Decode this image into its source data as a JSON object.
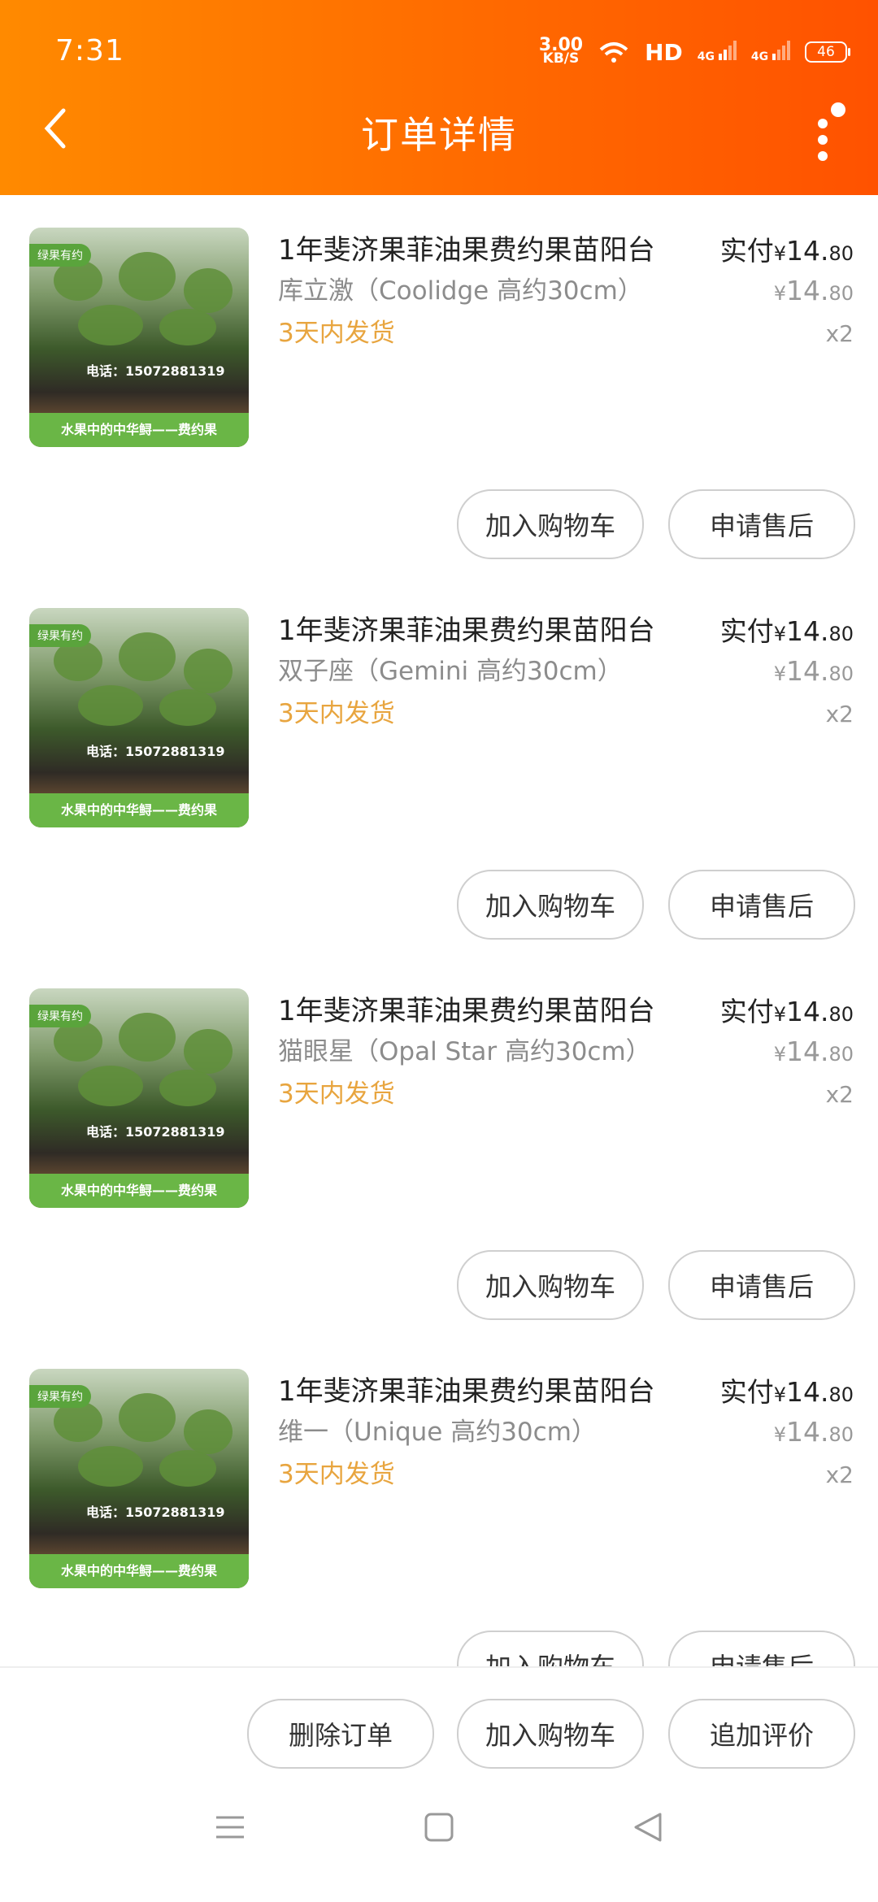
{
  "status_bar": {
    "time": "7:31",
    "net_speed_value": "3.00",
    "net_speed_unit": "KB/S",
    "network": "HD",
    "signal_1": "4G",
    "signal_2": "4G",
    "battery": "46"
  },
  "header": {
    "title": "订单详情",
    "accent_color": "#ff6a00"
  },
  "image_overlay": {
    "tag": "绿果有约",
    "phone": "电话：15072881319",
    "banner": "水果中的中华鲟——费约果"
  },
  "items": [
    {
      "name": "1年斐济果菲油果费约果苗阳台",
      "spec": "库立激（Coolidge  高约30cm）",
      "shipping": "3天内发货",
      "paid_label": "实付",
      "paid_yen": "¥",
      "paid_int": "14.",
      "paid_dec": "80",
      "price_yen": "¥",
      "price_int": "14.",
      "price_dec": "80",
      "qty": "x2",
      "btn_cart": "加入购物车",
      "btn_aftersale": "申请售后"
    },
    {
      "name": "1年斐济果菲油果费约果苗阳台",
      "spec": "双子座（Gemini  高约30cm）",
      "shipping": "3天内发货",
      "paid_label": "实付",
      "paid_yen": "¥",
      "paid_int": "14.",
      "paid_dec": "80",
      "price_yen": "¥",
      "price_int": "14.",
      "price_dec": "80",
      "qty": "x2",
      "btn_cart": "加入购物车",
      "btn_aftersale": "申请售后"
    },
    {
      "name": "1年斐济果菲油果费约果苗阳台",
      "spec": "猫眼星（Opal Star 高约30cm）",
      "shipping": "3天内发货",
      "paid_label": "实付",
      "paid_yen": "¥",
      "paid_int": "14.",
      "paid_dec": "80",
      "price_yen": "¥",
      "price_int": "14.",
      "price_dec": "80",
      "qty": "x2",
      "btn_cart": "加入购物车",
      "btn_aftersale": "申请售后"
    },
    {
      "name": "1年斐济果菲油果费约果苗阳台",
      "spec": "维一（Unique  高约30cm）",
      "shipping": "3天内发货",
      "paid_label": "实付",
      "paid_yen": "¥",
      "paid_int": "14.",
      "paid_dec": "80",
      "price_yen": "¥",
      "price_int": "14.",
      "price_dec": "80",
      "qty": "x2",
      "btn_cart": "加入购物车",
      "btn_aftersale": "申请售后"
    }
  ],
  "bottom_actions": {
    "delete_order": "删除订单",
    "add_to_cart": "加入购物车",
    "add_review": "追加评价"
  },
  "nav_icons": [
    "menu-icon",
    "home-square-icon",
    "back-triangle-icon"
  ]
}
